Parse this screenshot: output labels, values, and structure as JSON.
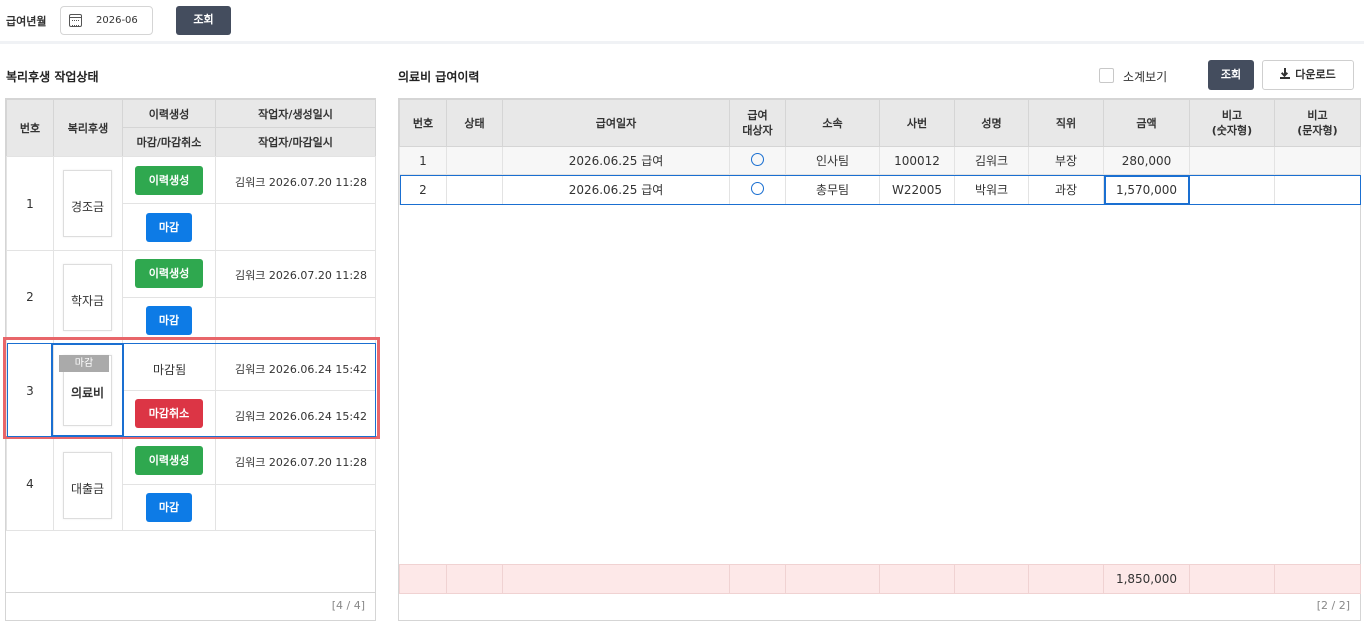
{
  "header": {
    "year_month_label": "급여년월",
    "year_month_value": "2026-06",
    "search_label": "조회"
  },
  "left": {
    "title": "복리후생 작업상태",
    "columns": {
      "no": "번호",
      "welfare": "복리후생",
      "history_create": "이력생성",
      "creator_time": "작업자/생성일시",
      "close_cancel": "마감/마감취소",
      "closer_time": "작업자/마감일시"
    },
    "rows": [
      {
        "no": "1",
        "name": "경조금",
        "create_label": "이력생성",
        "create_info": "김워크 2026.07.20 11:28",
        "close_label": "마감",
        "close_info": ""
      },
      {
        "no": "2",
        "name": "학자금",
        "create_label": "이력생성",
        "create_info": "김워크 2026.07.20 11:28",
        "close_label": "마감",
        "close_info": ""
      },
      {
        "no": "3",
        "name": "의료비",
        "badge": "마감",
        "create_label": "마감됨",
        "create_info": "김워크 2026.06.24 15:42",
        "close_label": "마감취소",
        "close_info": "김워크 2026.06.24 15:42"
      },
      {
        "no": "4",
        "name": "대출금",
        "create_label": "이력생성",
        "create_info": "김워크 2026.07.20 11:28",
        "close_label": "마감",
        "close_info": ""
      }
    ],
    "pager": "[4 / 4]"
  },
  "right": {
    "title": "의료비 급여이력",
    "subtotal_label": "소계보기",
    "search_label": "조회",
    "download_label": "다운로드",
    "columns": [
      "번호",
      "상태",
      "급여일자",
      "급여\n대상자",
      "소속",
      "사번",
      "성명",
      "직위",
      "금액",
      "비고\n(숫자형)",
      "비고\n(문자형)"
    ],
    "rows": [
      {
        "no": "1",
        "status": "",
        "pay_date": "2026.06.25 급여",
        "target": "○",
        "dept": "인사팀",
        "emp_no": "100012",
        "name": "김워크",
        "position": "부장",
        "amount": "280,000",
        "note_num": "",
        "note_text": ""
      },
      {
        "no": "2",
        "status": "",
        "pay_date": "2026.06.25 급여",
        "target": "○",
        "dept": "총무팀",
        "emp_no": "W22005",
        "name": "박워크",
        "position": "과장",
        "amount": "1,570,000",
        "note_num": "",
        "note_text": ""
      }
    ],
    "total_amount": "1,850,000",
    "pager": "[2 / 2]"
  },
  "colors": {
    "dark_button": "#444d5e",
    "green": "#2fa84f",
    "blue": "#0d7be6",
    "red": "#dc3545",
    "highlight_red": "#e8666a",
    "select_blue": "#1a6fd1",
    "sum_row": "#fde8e8"
  }
}
